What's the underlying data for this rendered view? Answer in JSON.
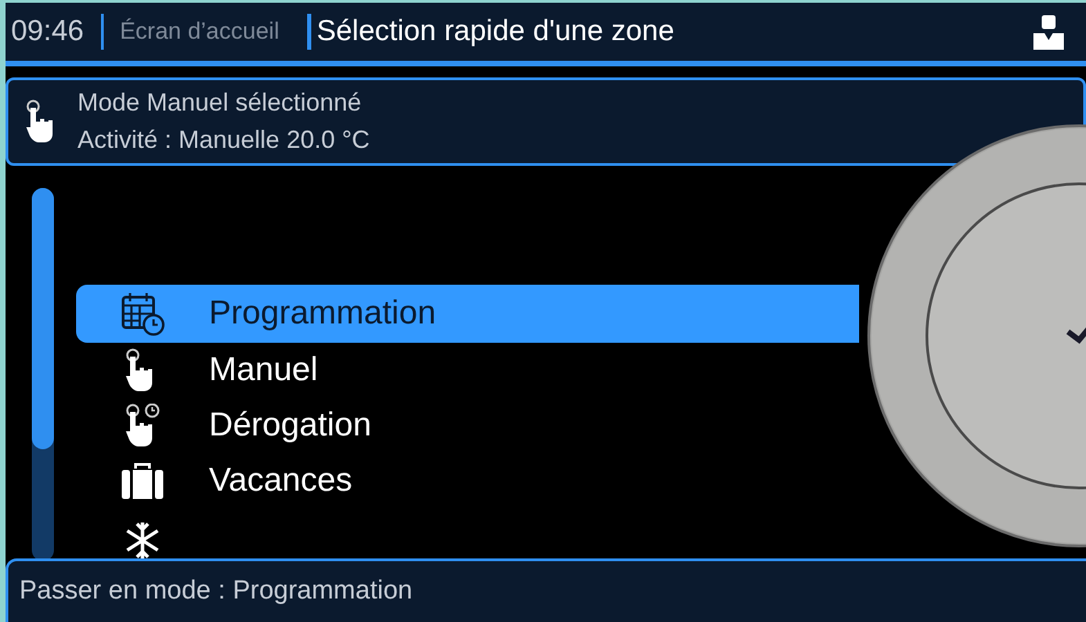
{
  "header": {
    "time": "09:46",
    "breadcrumb": "Écran d’accueil",
    "title": "Sélection rapide d'une zone"
  },
  "info": {
    "line1": "Mode Manuel sélectionné",
    "line2": "Activité : Manuelle 20.0 °C"
  },
  "menu": [
    {
      "label": "Programmation",
      "selected": true
    },
    {
      "label": "Manuel",
      "selected": false
    },
    {
      "label": "Dérogation",
      "selected": false
    },
    {
      "label": "Vacances",
      "selected": false
    }
  ],
  "scrollbar": {
    "level": 0.7
  },
  "footer": {
    "text": "Passer en mode : Programmation"
  }
}
